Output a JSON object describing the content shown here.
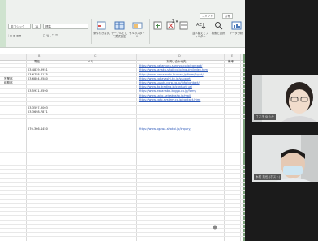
{
  "ribbon": {
    "font_name": "游ゴシック",
    "font_size": "11",
    "style_box": "標準",
    "cell_styles": "表示形式",
    "top_btn1": "コメント",
    "top_btn2": "共有",
    "buttons": [
      {
        "label": "条件付き書式"
      },
      {
        "label": "テーブルとして書式設定"
      },
      {
        "label": "セルのスタイル"
      },
      {
        "label": "挿入"
      },
      {
        "label": "削除"
      },
      {
        "label": "書式"
      },
      {
        "label": "並べ替えとフィルター"
      },
      {
        "label": "検索と選択"
      },
      {
        "label": "データ分析"
      }
    ],
    "colors": {
      "background": "#eef1ee",
      "accent": "#cfe3cf"
    }
  },
  "sheet": {
    "column_headers": [
      "B",
      "C",
      "D",
      "E"
    ],
    "header_row": {
      "phone": "電話",
      "notes": "メモ",
      "url": "お問い合わせ先",
      "status": "備考"
    },
    "rows": [
      {
        "name": "",
        "phone": "",
        "url": "https://www.nakamura-sangyo.co.jp/contact/"
      },
      {
        "name": "",
        "phone": "03-4839-3951",
        "url": "https://www.tanaka-shoji.co.jp/inquiry/index.html"
      },
      {
        "name": "",
        "phone": "03-6758-7175",
        "url": "https://www.yamamoto-bussan.jp/form/input/"
      },
      {
        "name": "営業部",
        "phone": "03-6804-3580",
        "url": "https://www.kobayashi-kk.jp/support/"
      },
      {
        "name": "総務部",
        "phone": "",
        "url": "https://www.suzuki-corp.co.jp/info/contact/"
      },
      {
        "name": "",
        "phone": "",
        "url": "https://www.ito-trading.jp/contact_us/"
      },
      {
        "name": "",
        "phone": "03-5931-3590",
        "url": "https://www.watanabe-kogyo.co.jp/form/"
      },
      {
        "name": "",
        "phone": "",
        "url": "https://www.saito-seisakusho.jp/mail/"
      },
      {
        "name": "",
        "phone": "",
        "url": "https://www.kato-system.co.jp/contact.html"
      },
      {
        "name": "",
        "phone": "",
        "url": ""
      },
      {
        "name": "",
        "phone": "03-3597-3003",
        "url": ""
      },
      {
        "name": "",
        "phone": "03-3698-7871",
        "url": ""
      },
      {
        "name": "",
        "phone": "",
        "url": ""
      },
      {
        "name": "",
        "phone": "",
        "url": ""
      },
      {
        "name": "",
        "phone": "",
        "url": ""
      },
      {
        "name": "",
        "phone": "070-366-4450",
        "url": "https://www.ogawa-shokai.jp/inquiry/"
      }
    ]
  },
  "participants": [
    {
      "name": "ささき ゆうか"
    },
    {
      "name": "木村 拓也 (ホスト)"
    }
  ]
}
